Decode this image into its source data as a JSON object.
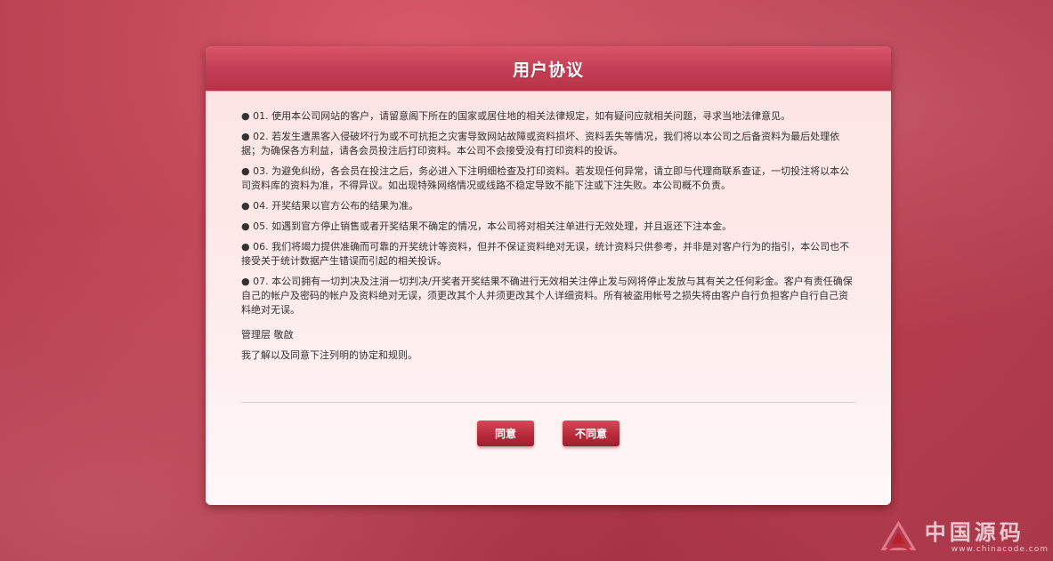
{
  "dialog": {
    "title": "用户协议",
    "clauses": [
      "● 01. 使用本公司网站的客户，请留意阁下所在的国家或居住地的相关法律规定，如有疑问应就相关问题，寻求当地法律意见。",
      "● 02. 若发生遭黑客入侵破坏行为或不可抗拒之灾害导致网站故障或资料损坏、资料丢失等情况，我们将以本公司之后备资料为最后处理依据；为确保各方利益，请各会员投注后打印资料。本公司不会接受没有打印资料的投诉。",
      "● 03. 为避免纠纷，各会员在投注之后，务必进入下注明细检查及打印资料。若发现任何异常，请立即与代理商联系查证，一切投注将以本公司资料库的资料为准，不得异议。如出现特殊网络情况或线路不稳定导致不能下注或下注失败。本公司概不负责。",
      "● 04. 开奖结果以官方公布的结果为准。",
      "● 05. 如遇到官方停止销售或者开奖结果不确定的情况，本公司将对相关注单进行无效处理，并且返还下注本金。",
      "● 06. 我们将竭力提供准确而可靠的开奖统计等资料，但并不保证资料绝对无误，统计资料只供参考，并非是对客户行为的指引，本公司也不接受关于统计数据产生错误而引起的相关投诉。",
      "● 07. 本公司拥有一切判决及注消一切判决/开奖者开奖结果不确进行无效相关注停止发与网将停止发放与其有关之任何彩金。客户有责任确保自己的帐户及密码的帐户及资料绝对无误，须更改其个人并须更改其个人详细资料。所有被盗用帐号之损失将由客户自行负担客户自行自己资料绝对无误。"
    ],
    "signature": "管理层 敬啟",
    "consent": "我了解以及同意下注列明的协定和规则。",
    "agree_label": "同意",
    "disagree_label": "不同意"
  },
  "watermark": {
    "brand": "中国源码",
    "url": "www.chinacode.com",
    "logo_icon": "triangle-logo-icon"
  },
  "colors": {
    "background": "#b53d4d",
    "header": "#c33f55",
    "button": "#b82a3c"
  }
}
